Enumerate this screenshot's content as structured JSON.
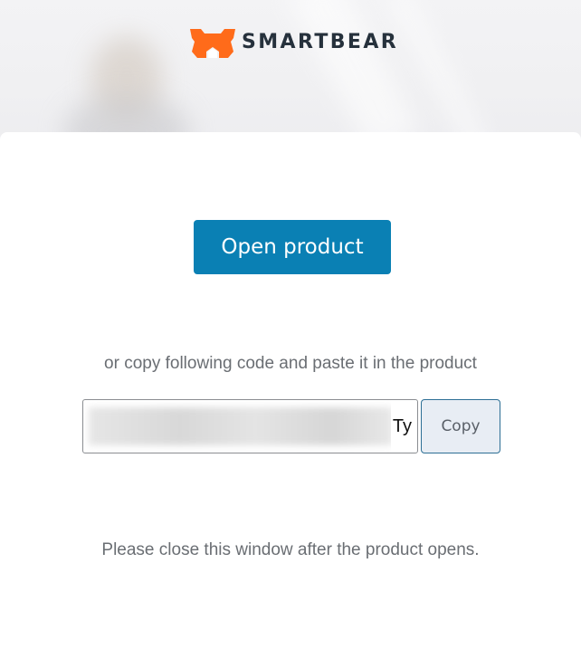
{
  "header": {
    "brand": "SMARTBEAR",
    "logo_icon": "smartbear-bear-icon",
    "brand_color": "#ff6b1a"
  },
  "main": {
    "open_button_label": "Open product",
    "instruction": "or copy following code and paste it in the product",
    "code_field": {
      "visible_value": "Ty",
      "obscured": true
    },
    "copy_button_label": "Copy",
    "close_note": "Please close this window after the product opens."
  },
  "colors": {
    "primary_button": "#0a80b4",
    "copy_button_bg": "#e8edf4",
    "copy_button_border": "#2d6f95",
    "text_muted": "#6a6e73"
  }
}
